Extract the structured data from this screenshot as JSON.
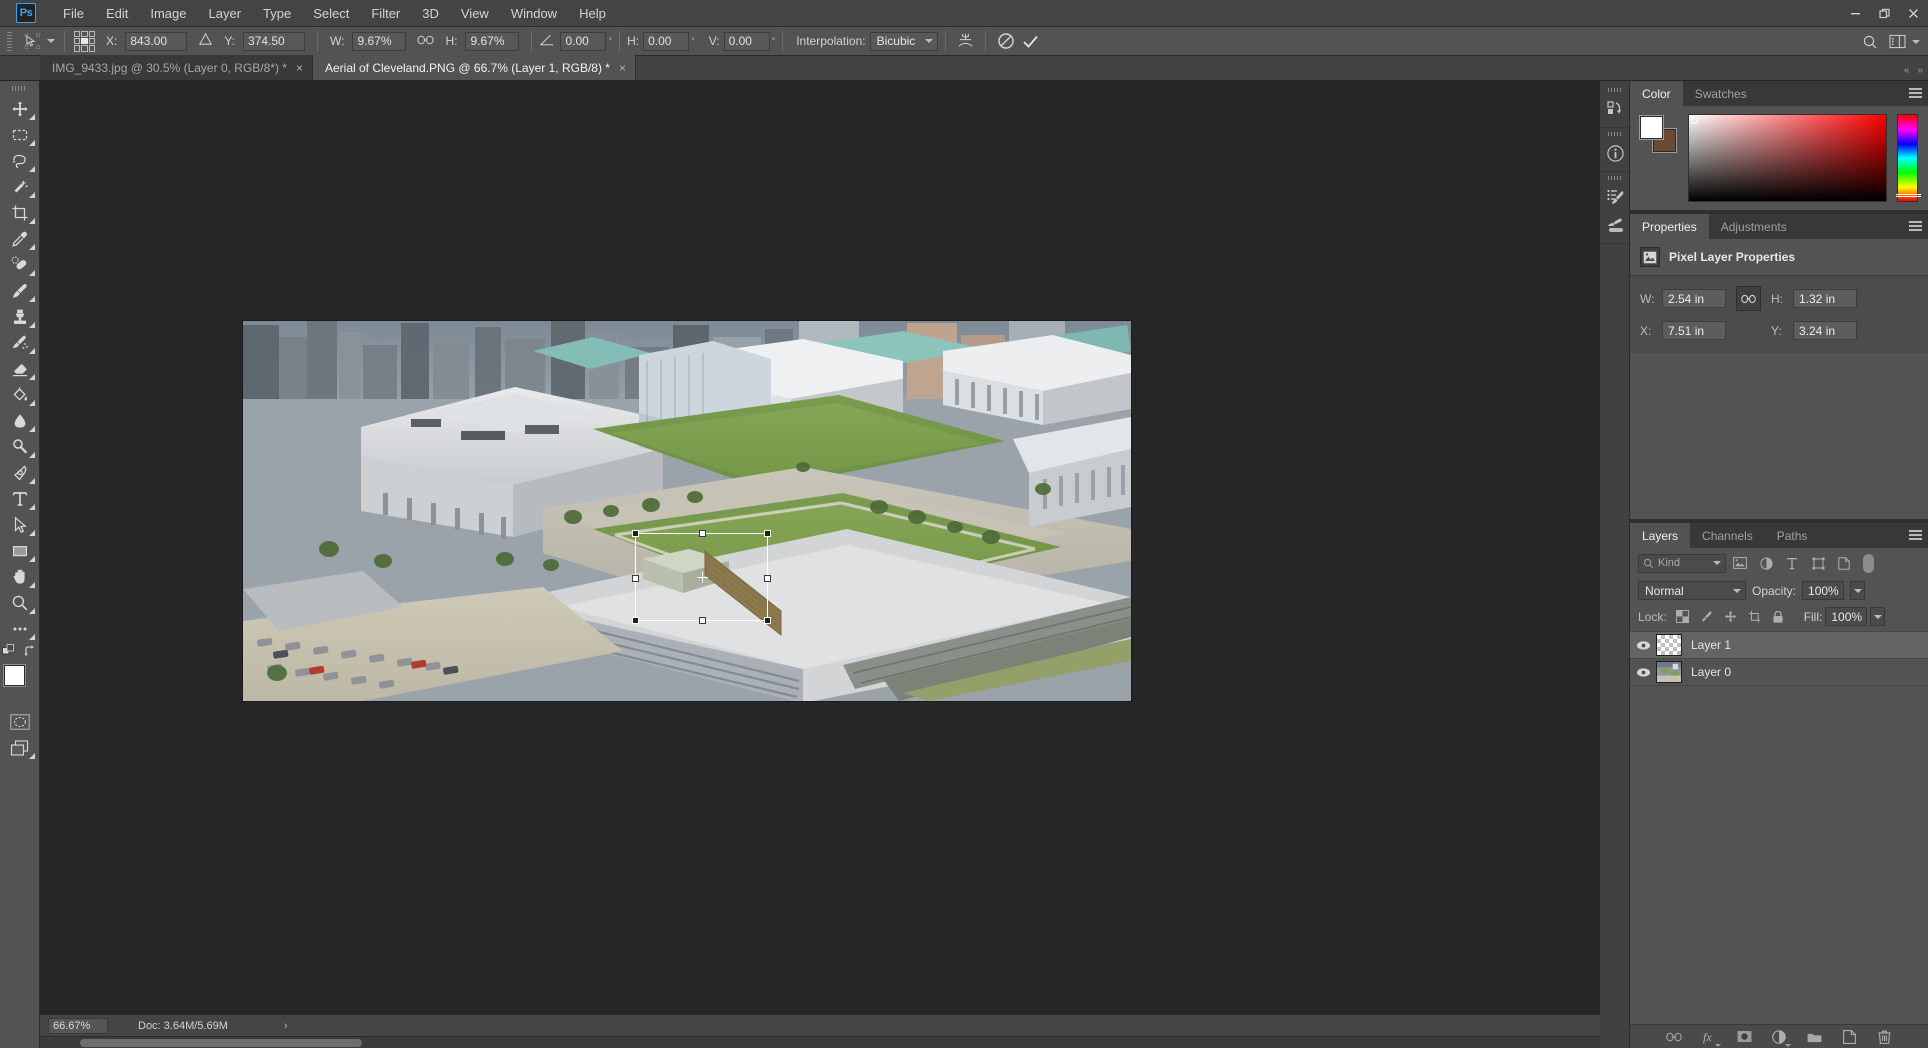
{
  "app": {
    "logo": "Ps",
    "menu": [
      "File",
      "Edit",
      "Image",
      "Layer",
      "Type",
      "Select",
      "Filter",
      "3D",
      "View",
      "Window",
      "Help"
    ],
    "window_controls": {
      "minimize": "minimize-icon",
      "restore": "restore-icon",
      "close": "close-icon"
    }
  },
  "options_bar": {
    "tool_preset_icon": "move-tool-icon",
    "reference_point_label": "reference-point-grid",
    "x_label": "X:",
    "x_value": "843.00 px",
    "y_label": "Y:",
    "y_value": "374.50 px",
    "w_label": "W:",
    "w_value": "9.67%",
    "h_label": "H:",
    "h_value": "9.67%",
    "link_icon": "link-icon",
    "rotate_label": "",
    "rotate_value": "0.00",
    "skew_h_label": "H:",
    "skew_h_value": "0.00",
    "skew_v_label": "V:",
    "skew_v_value": "0.00",
    "degree_symbol": "°",
    "interpolation_label": "Interpolation:",
    "interpolation_value": "Bicubic",
    "warp_icon": "warp-mode-icon",
    "cancel_icon": "cancel-transform-icon",
    "commit_icon": "commit-transform-icon",
    "search_icon": "search-icon",
    "workspace_icon": "workspace-switcher-icon"
  },
  "tabs": [
    {
      "label": "IMG_9433.jpg @ 30.5% (Layer 0, RGB/8*) *",
      "active": false,
      "close": "×"
    },
    {
      "label": "Aerial of Cleveland.PNG @ 66.7% (Layer 1, RGB/8) *",
      "active": true,
      "close": "×"
    }
  ],
  "toolbar": {
    "tools": [
      {
        "name": "move-tool",
        "icon": "move-icon",
        "active": false
      },
      {
        "name": "marquee-tool",
        "icon": "rectangular-marquee-icon",
        "active": false
      },
      {
        "name": "lasso-tool",
        "icon": "lasso-icon",
        "active": false
      },
      {
        "name": "quick-selection-tool",
        "icon": "magic-wand-icon",
        "active": false
      },
      {
        "name": "crop-tool",
        "icon": "crop-icon",
        "active": false
      },
      {
        "name": "eyedropper-tool",
        "icon": "eyedropper-icon",
        "active": false
      },
      {
        "name": "healing-brush-tool",
        "icon": "healing-brush-icon",
        "active": false
      },
      {
        "name": "brush-tool",
        "icon": "brush-icon",
        "active": false
      },
      {
        "name": "clone-stamp-tool",
        "icon": "clone-stamp-icon",
        "active": false
      },
      {
        "name": "history-brush-tool",
        "icon": "history-brush-icon",
        "active": false
      },
      {
        "name": "eraser-tool",
        "icon": "eraser-icon",
        "active": false
      },
      {
        "name": "gradient-tool",
        "icon": "paint-bucket-icon",
        "active": false
      },
      {
        "name": "blur-tool",
        "icon": "blur-drop-icon",
        "active": false
      },
      {
        "name": "dodge-tool",
        "icon": "dodge-icon",
        "active": false
      },
      {
        "name": "pen-tool",
        "icon": "pen-icon",
        "active": false
      },
      {
        "name": "type-tool",
        "icon": "type-t-icon",
        "active": false
      },
      {
        "name": "path-selection-tool",
        "icon": "path-arrow-icon",
        "active": false
      },
      {
        "name": "rectangle-tool",
        "icon": "rectangle-shape-icon",
        "active": false
      },
      {
        "name": "hand-tool",
        "icon": "hand-icon",
        "active": false
      },
      {
        "name": "zoom-tool",
        "icon": "magnifier-icon",
        "active": false
      },
      {
        "name": "edit-toolbar",
        "icon": "ellipsis-icon",
        "active": false
      }
    ],
    "foreground_color": "#ffffff",
    "background_color": "#6b4a33",
    "default_colors_icon": "default-colors-icon",
    "swap_colors_icon": "swap-colors-icon",
    "quick_mask_icon": "quick-mask-icon",
    "screen_mode_icon": "screen-mode-icon"
  },
  "canvas": {
    "document_title": "Aerial of Cleveland.PNG",
    "transform_active": true,
    "reference_point": "center"
  },
  "status_bar": {
    "zoom": "66.67%",
    "doc_info": "Doc: 3.64M/5.69M",
    "expand_arrow": "›"
  },
  "dock_rail": [
    {
      "name": "history-panel-icon",
      "label": "History"
    },
    {
      "name": "info-panel-icon",
      "label": "Info"
    },
    {
      "name": "brush-presets-icon",
      "label": "Brush Presets"
    },
    {
      "name": "brush-settings-icon",
      "label": "Brush Settings"
    }
  ],
  "color_panel": {
    "tabs": [
      {
        "label": "Color",
        "active": true
      },
      {
        "label": "Swatches",
        "active": false
      }
    ],
    "foreground": "#ffffff",
    "background": "#6b4a33",
    "menu_icon": "panel-menu-icon"
  },
  "properties_panel": {
    "tabs": [
      {
        "label": "Properties",
        "active": true
      },
      {
        "label": "Adjustments",
        "active": false
      }
    ],
    "title": "Pixel Layer Properties",
    "title_icon": "pixel-layer-icon",
    "w_label": "W:",
    "w_value": "2.54 in",
    "h_label": "H:",
    "h_value": "1.32 in",
    "x_label": "X:",
    "x_value": "7.51 in",
    "y_label": "Y:",
    "y_value": "3.24 in",
    "link_icon": "link-dimensions-icon",
    "menu_icon": "panel-menu-icon"
  },
  "layers_panel": {
    "tabs": [
      {
        "label": "Layers",
        "active": true
      },
      {
        "label": "Channels",
        "active": false
      },
      {
        "label": "Paths",
        "active": false
      }
    ],
    "filter_placeholder": "Kind",
    "filter_icons": [
      "filter-pixel-icon",
      "filter-adjustment-icon",
      "filter-type-icon",
      "filter-shape-icon",
      "filter-smart-object-icon"
    ],
    "filter_toggle": "filter-enable-toggle",
    "blend_mode": "Normal",
    "opacity_label": "Opacity:",
    "opacity_value": "100%",
    "lock_label": "Lock:",
    "lock_icons": [
      "lock-transparent-pixels-icon",
      "lock-image-pixels-icon",
      "lock-position-icon",
      "lock-artboard-icon",
      "lock-all-icon"
    ],
    "fill_label": "Fill:",
    "fill_value": "100%",
    "layers": [
      {
        "name": "Layer 1",
        "selected": true,
        "visible": true,
        "thumb": "transparent"
      },
      {
        "name": "Layer 0",
        "selected": false,
        "visible": true,
        "thumb": "photo"
      }
    ],
    "footer_buttons": [
      "link-layers-icon",
      "layer-style-fx-icon",
      "add-layer-mask-icon",
      "new-adjustment-layer-icon",
      "new-group-icon",
      "new-layer-icon",
      "delete-layer-icon"
    ],
    "menu_icon": "panel-menu-icon"
  }
}
